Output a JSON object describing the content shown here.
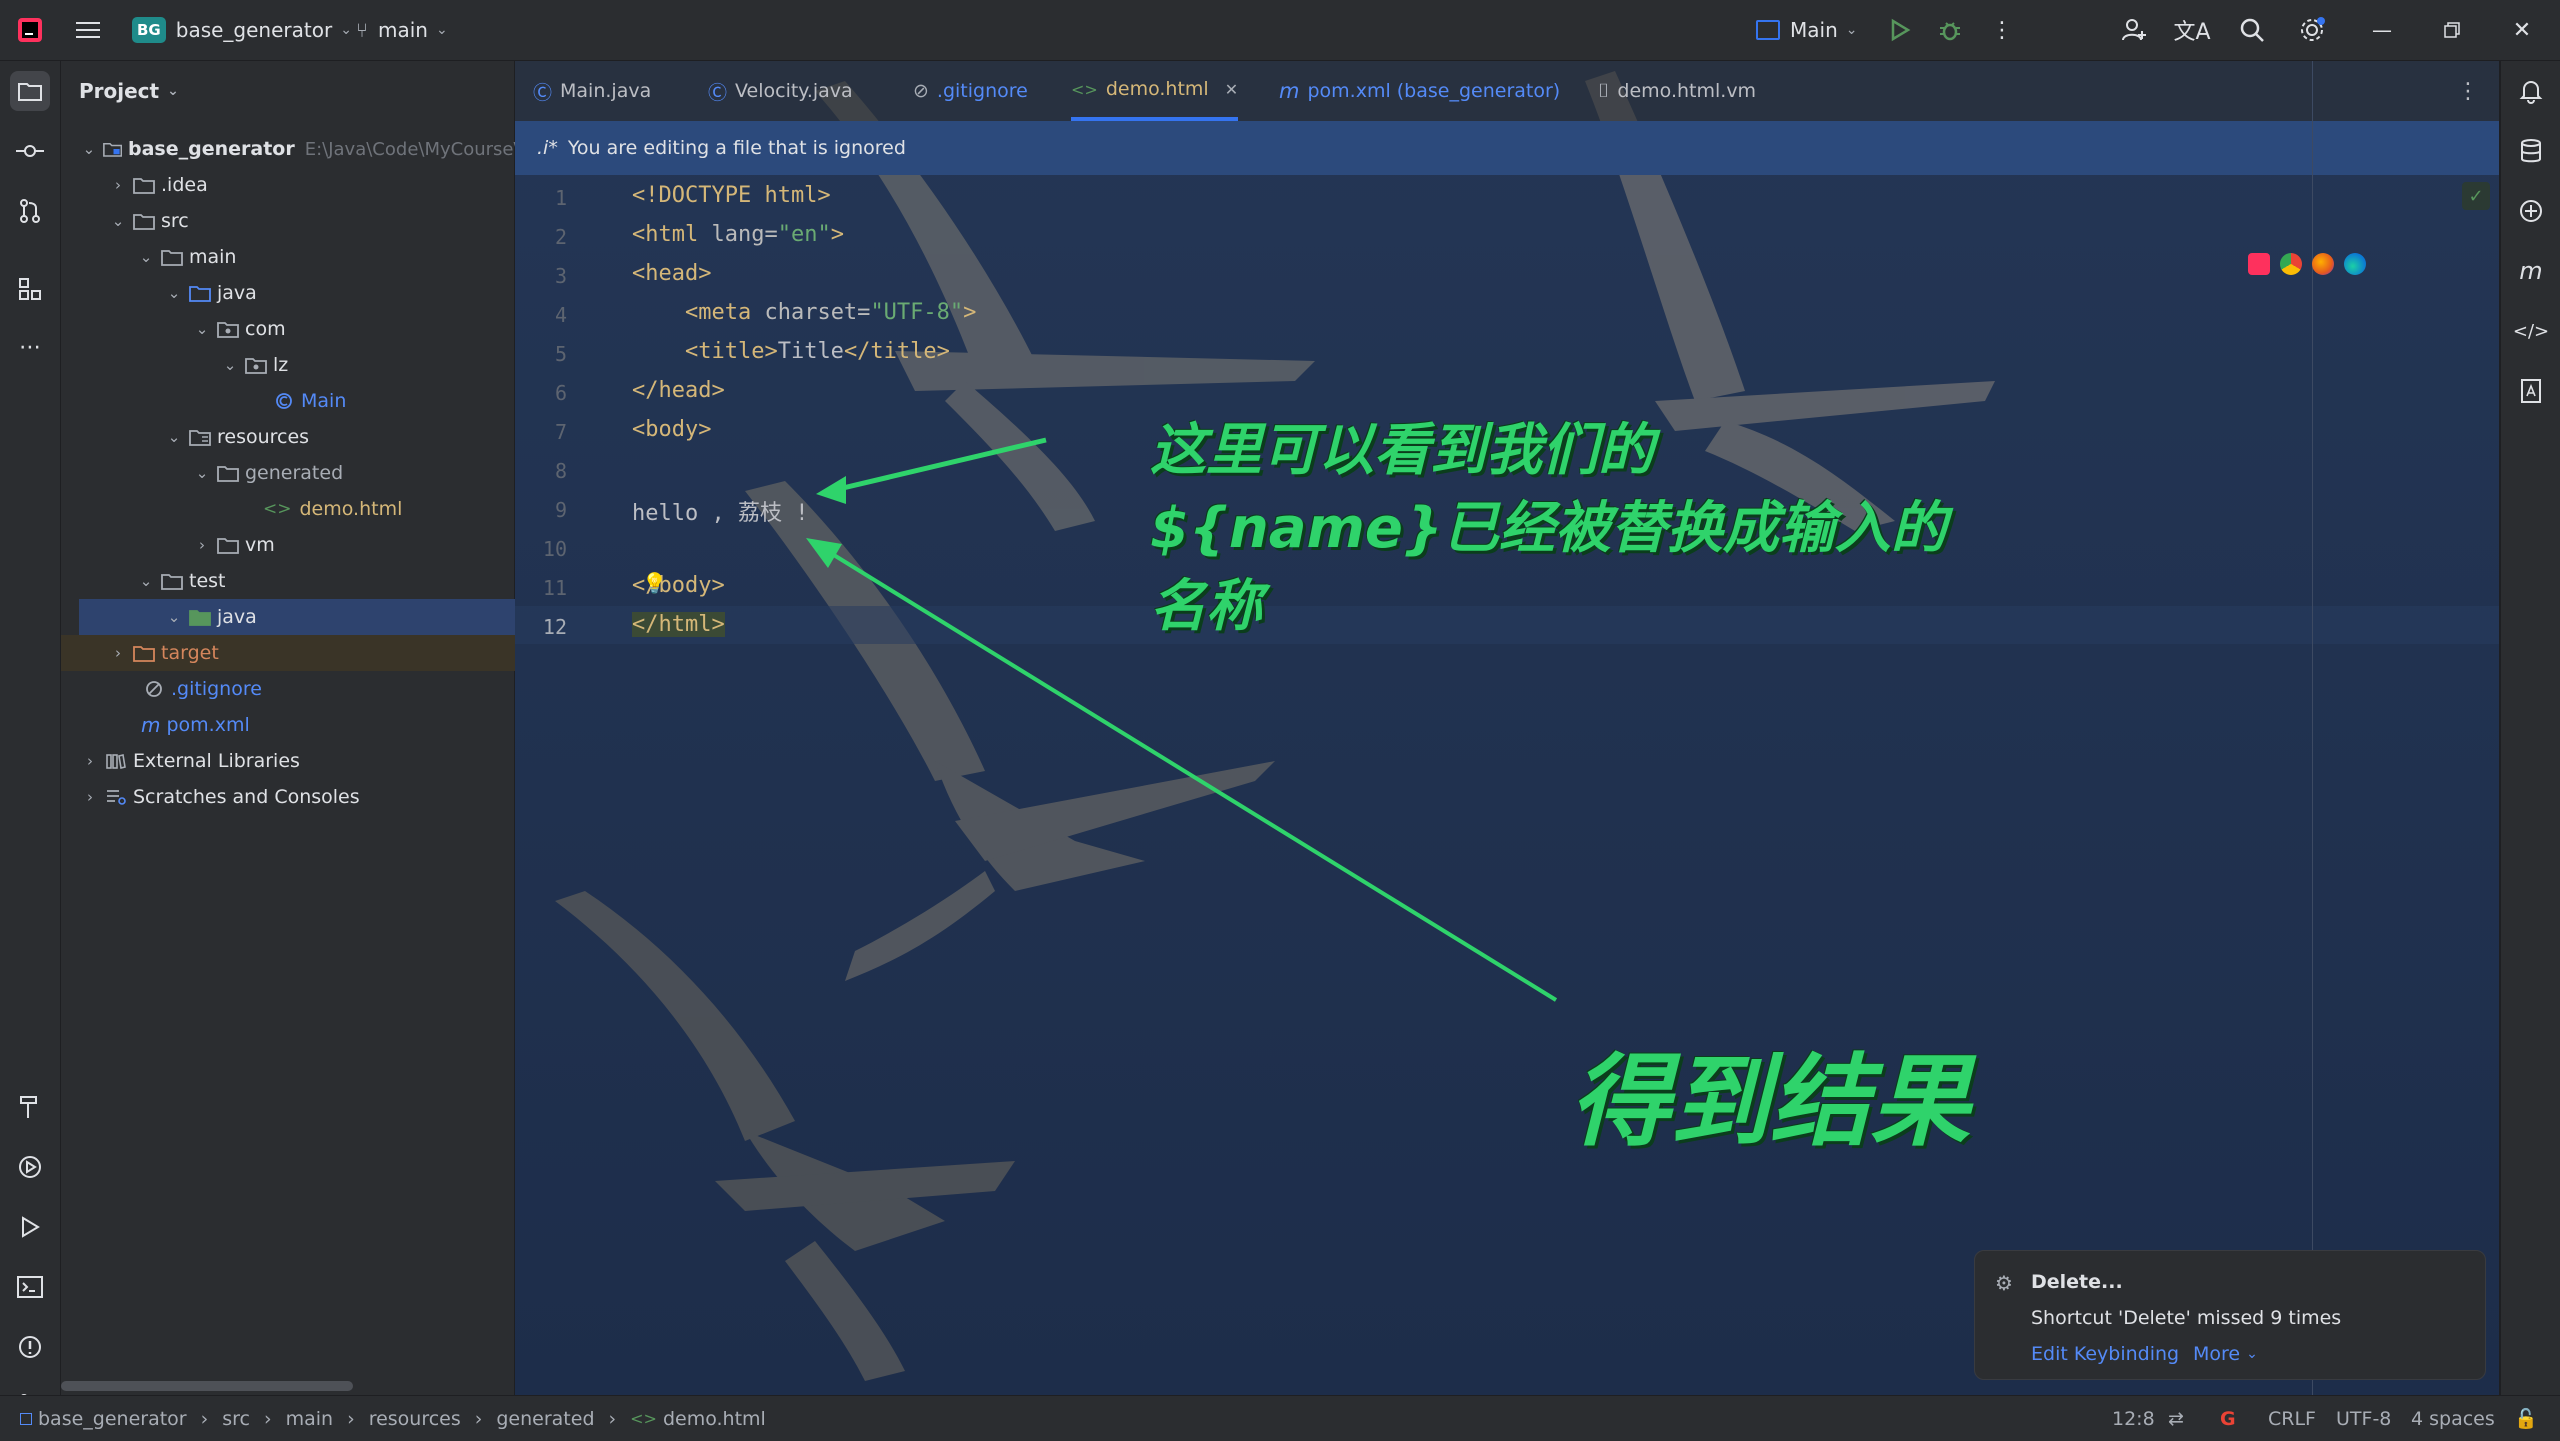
{
  "titlebar": {
    "project_badge": "BG",
    "project_name": "base_generator",
    "branch": "main",
    "run_config": "Main"
  },
  "project_panel": {
    "title": "Project",
    "root_name": "base_generator",
    "root_path": "E:\\Java\\Code\\MyCourse\\lz",
    "items": [
      {
        "label": ".idea"
      },
      {
        "label": "src"
      },
      {
        "label": "main"
      },
      {
        "label": "java"
      },
      {
        "label": "com"
      },
      {
        "label": "lz"
      },
      {
        "label": "Main"
      },
      {
        "label": "resources"
      },
      {
        "label": "generated"
      },
      {
        "label": "demo.html"
      },
      {
        "label": "vm"
      },
      {
        "label": "test"
      },
      {
        "label": "java"
      },
      {
        "label": "target"
      },
      {
        "label": ".gitignore"
      },
      {
        "label": "pom.xml"
      },
      {
        "label": "External Libraries"
      },
      {
        "label": "Scratches and Consoles"
      }
    ]
  },
  "tabs": [
    {
      "label": "Main.java"
    },
    {
      "label": "Velocity.java"
    },
    {
      "label": ".gitignore"
    },
    {
      "label": "demo.html"
    },
    {
      "label": "pom.xml (base_generator)"
    },
    {
      "label": "demo.html.vm"
    }
  ],
  "banner": {
    "icon_text": ".i*",
    "text": "You are editing a file that is ignored"
  },
  "code": {
    "line_numbers": [
      "1",
      "2",
      "3",
      "4",
      "5",
      "6",
      "7",
      "8",
      "9",
      "10",
      "11",
      "12"
    ],
    "l1": "<!DOCTYPE html>",
    "l2_open": "<html",
    "l2_attr": " lang=",
    "l2_val": "\"en\"",
    "l2_close": ">",
    "l3": "<head>",
    "l4_open": "    <meta",
    "l4_attr": " charset=",
    "l4_val": "\"UTF-8\"",
    "l4_close": ">",
    "l5_open": "    <title>",
    "l5_text": "Title",
    "l5_close": "</title>",
    "l6": "</head>",
    "l7": "<body>",
    "l9": "hello , 荔枝 !",
    "l11": "</body>",
    "l12": "</html>"
  },
  "annotations": {
    "note_line1": "这里可以看到我们的",
    "note_line2": "${name}已经被替换成输入的",
    "note_line3": "名称",
    "result": "得到结果"
  },
  "notification": {
    "title": "Delete...",
    "body": "Shortcut 'Delete' missed 9 times",
    "action1": "Edit Keybinding",
    "action2": "More"
  },
  "statusbar": {
    "crumbs": [
      "base_generator",
      "src",
      "main",
      "resources",
      "generated",
      "demo.html"
    ],
    "position": "12:8",
    "line_sep": "CRLF",
    "encoding": "UTF-8",
    "indent": "4 spaces"
  },
  "colors": {
    "accent_green": "#2fd36b",
    "editor_bg": "#1f2f4d",
    "banner_bg": "#2c4a7c",
    "tab_active": "#3574f0"
  }
}
